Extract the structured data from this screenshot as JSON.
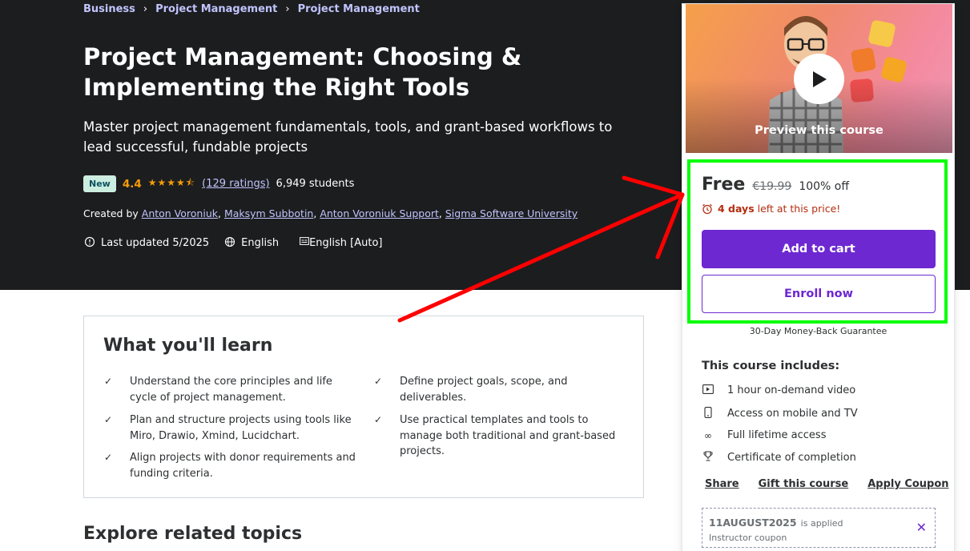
{
  "breadcrumb": [
    "Business",
    "Project Management",
    "Project Management"
  ],
  "breadcrumb_sep": "›",
  "course": {
    "title": "Project Management: Choosing & Implementing the Right Tools",
    "subtitle": "Master project management fundamentals, tools, and grant-based workflows to lead successful, fundable projects",
    "badge": "New",
    "rating": "4.4",
    "rating_stars": 4.4,
    "ratings_count": "(129 ratings)",
    "students": "6,949 students",
    "created_by_label": "Created by",
    "authors": [
      "Anton Voroniuk",
      "Maksym Subbotin",
      "Anton Voroniuk Support",
      "Sigma Software University"
    ],
    "last_updated": "Last updated 5/2025",
    "language": "English",
    "captions": "English [Auto]"
  },
  "learn": {
    "title": "What you'll learn",
    "items": [
      "Understand the core principles and life cycle of project management.",
      "Define project goals, scope, and deliverables.",
      "Plan and structure projects using tools like Miro, Drawio, Xmind, Lucidchart.",
      "Use practical templates and tools to manage both traditional and grant-based projects.",
      "Align projects with donor requirements and funding criteria."
    ]
  },
  "explore_title": "Explore related topics",
  "sidebar": {
    "preview_label": "Preview this course",
    "price": "Free",
    "original_price": "€19.99",
    "discount": "100% off",
    "timer_strong": "4 days",
    "timer_rest": " left at this price!",
    "add_to_cart": "Add to cart",
    "enroll_now": "Enroll now",
    "guarantee": "30-Day Money-Back Guarantee",
    "includes_title": "This course includes:",
    "includes": [
      {
        "icon": "video-icon",
        "text": "1 hour on-demand video"
      },
      {
        "icon": "mobile-icon",
        "text": "Access on mobile and TV"
      },
      {
        "icon": "infinity-icon",
        "text": "Full lifetime access"
      },
      {
        "icon": "trophy-icon",
        "text": "Certificate of completion"
      }
    ],
    "links": [
      "Share",
      "Gift this course",
      "Apply Coupon"
    ],
    "coupon_code": "11AUGUST2025",
    "coupon_applied": "is applied",
    "coupon_sub": "Instructor coupon"
  },
  "colors": {
    "hero_bg": "#1c1d1f",
    "accent": "#6d28d2",
    "link_light": "#c0c4fc",
    "star": "#f69c08",
    "timer": "#b32d0f",
    "annotation_box": "#00ff00",
    "annotation_arrow": "#ff0000"
  }
}
